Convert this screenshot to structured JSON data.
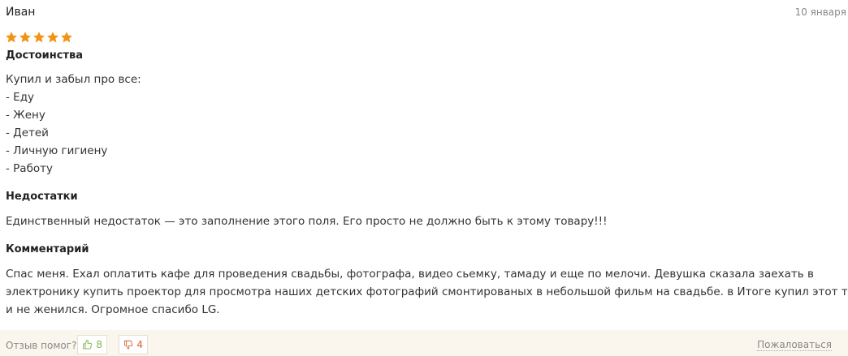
{
  "review": {
    "author": "Иван",
    "date": "10 января",
    "rating": {
      "value": 5,
      "max": 5,
      "color": "#f29315"
    },
    "pros": {
      "title": "Достоинства",
      "lines": [
        "Купил и забыл про все:",
        "- Еду",
        "- Жену",
        "- Детей",
        "- Личную гигиену",
        "- Работу"
      ]
    },
    "cons": {
      "title": "Недостатки",
      "lines": [
        "Единственный недостаток — это заполнение этого поля. Его просто не должно быть к этому товару!!!"
      ]
    },
    "comment": {
      "title": "Комментарий",
      "lines": [
        "Спас меня. Ехал оплатить кафе для проведения свадьбы, фотографа, видео сьемку, тамаду и еще по мелочи. Девушка сказала заехать в",
        "электронику купить проектор для просмотра наших детских фотографий смонтированых в небольшой фильм на свадьбе. в Итоге купил этот телик",
        "и не женился. Огромное спасибо LG."
      ]
    }
  },
  "footer": {
    "helpful_question": "Отзыв помог?",
    "upvote": {
      "icon": "thumbs-up-icon",
      "count": "8",
      "color": "#8bb84a"
    },
    "downvote": {
      "icon": "thumbs-down-icon",
      "count": "4",
      "color": "#d06633"
    },
    "report_label": "Пожаловаться"
  }
}
